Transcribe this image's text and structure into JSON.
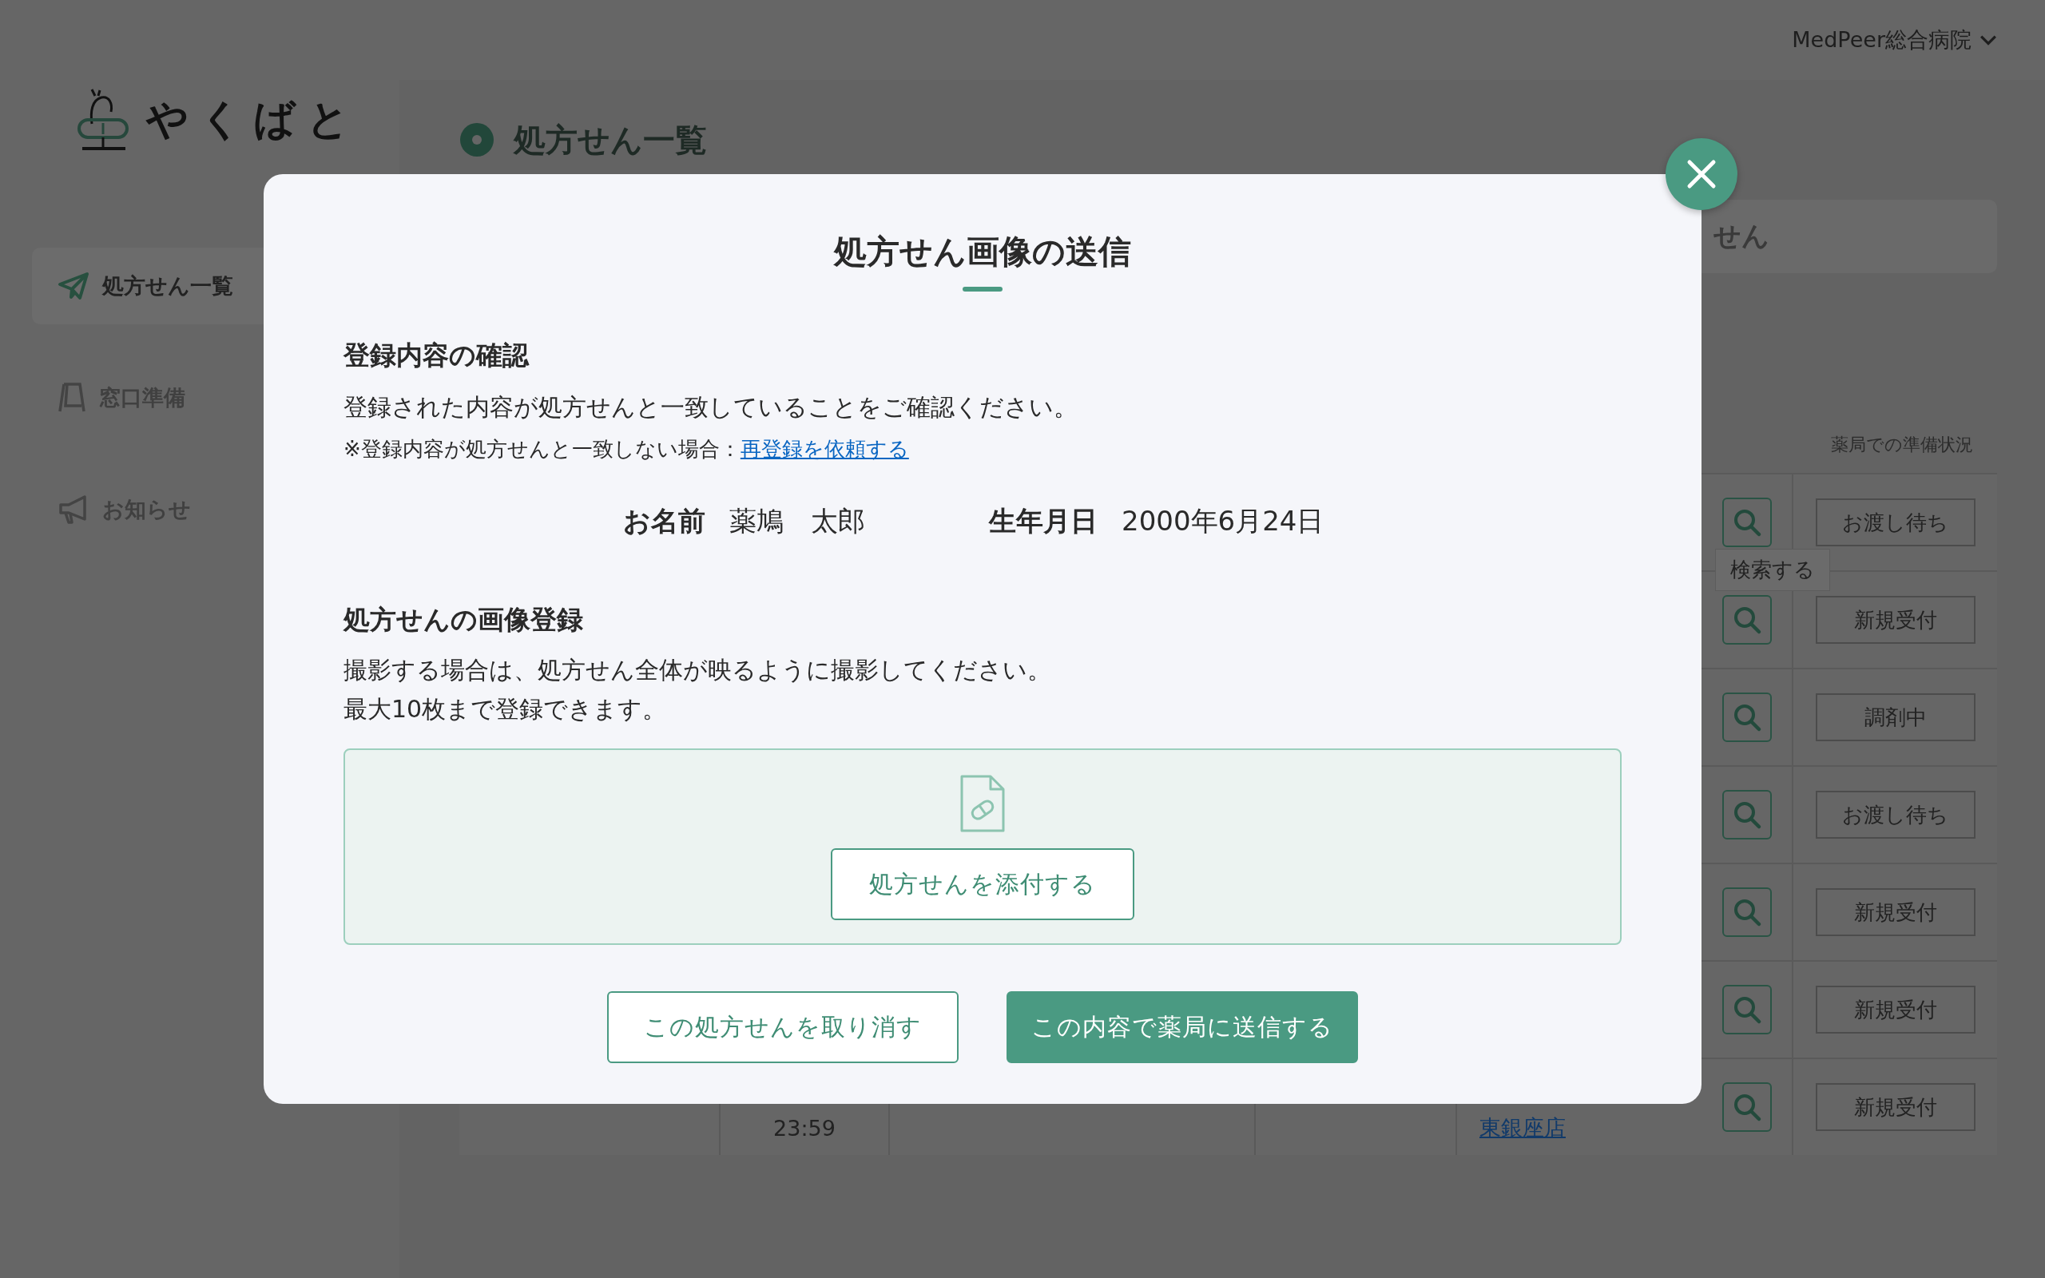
{
  "header": {
    "hospital": "MedPeer総合病院"
  },
  "sidebar": {
    "logo": "やくばと",
    "items": [
      {
        "label": "処方せん一覧",
        "selected": true
      },
      {
        "label": "窓口準備",
        "selected": false
      },
      {
        "label": "お知らせ",
        "selected": false
      }
    ]
  },
  "page": {
    "title": "処方せん一覧",
    "search_text": "せん",
    "status_heading": "薬局での準備状況",
    "tooltip": "検索する",
    "rows": [
      {
        "status": "お渡し待ち"
      },
      {
        "status": "新規受付"
      },
      {
        "status": "調剤中"
      },
      {
        "status": "お渡し待ち"
      },
      {
        "status": "新規受付"
      },
      {
        "status": "新規受付"
      },
      {
        "status": "新規受付",
        "time": "23:59",
        "pharmacy": "東銀座店"
      }
    ]
  },
  "modal": {
    "title": "処方せん画像の送信",
    "confirm": {
      "heading": "登録内容の確認",
      "text": "登録された内容が処方せんと一致していることをご確認ください。",
      "note": "※登録内容が処方せんと一致しない場合：",
      "link": "再登録を依頼する",
      "fields": [
        {
          "label": "お名前",
          "value": "薬鳩　太郎"
        },
        {
          "label": "生年月日",
          "value": "2000年6月24日"
        }
      ]
    },
    "upload": {
      "heading": "処方せんの画像登録",
      "lines": [
        "撮影する場合は、処方せん全体が映るように撮影してください。",
        "最大10枚まで登録できます。"
      ],
      "button": "処方せんを添付する"
    },
    "buttons": [
      {
        "label": "この処方せんを取り消す",
        "kind": "secondary"
      },
      {
        "label": "この内容で薬局に送信する",
        "kind": "primary"
      }
    ]
  }
}
